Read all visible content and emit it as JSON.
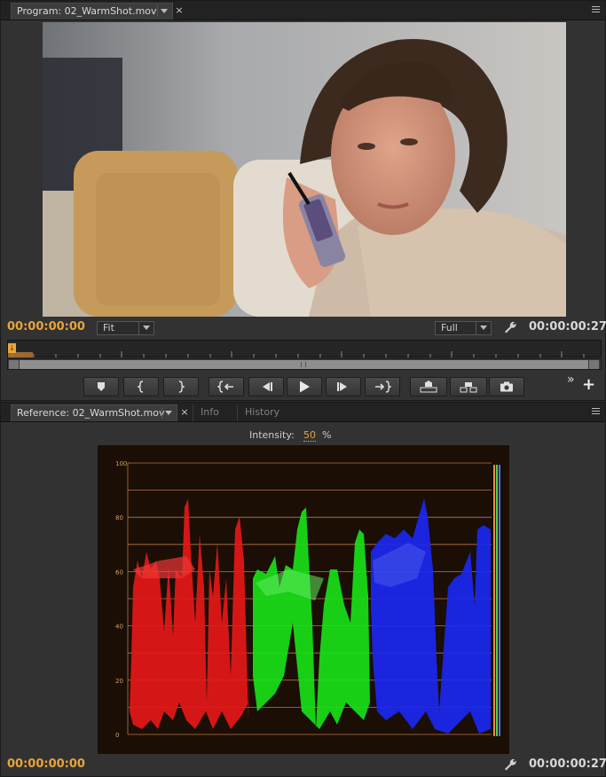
{
  "program_panel": {
    "tab_title": "Program: 02_WarmShot.mov",
    "close_label": "×",
    "current_timecode": "00:00:00:00",
    "zoom_dropdown": "Fit",
    "quality_dropdown": "Full",
    "duration_timecode": "00:00:00:27",
    "playhead_marker": "↓",
    "more_label": "»",
    "add_label": "+",
    "transport_buttons": [
      {
        "name": "add-marker-button",
        "icon": "marker-icon"
      },
      {
        "name": "mark-in-button",
        "icon": "mark-in-icon",
        "label": "{"
      },
      {
        "name": "mark-out-button",
        "icon": "mark-out-icon",
        "label": "}"
      },
      {
        "name": "go-to-in-button",
        "icon": "go-to-in-icon",
        "label": "{←"
      },
      {
        "name": "step-back-button",
        "icon": "step-back-icon"
      },
      {
        "name": "play-button",
        "icon": "play-icon"
      },
      {
        "name": "step-forward-button",
        "icon": "step-forward-icon"
      },
      {
        "name": "go-to-out-button",
        "icon": "go-to-out-icon",
        "label": "→}"
      },
      {
        "name": "lift-button",
        "icon": "lift-icon"
      },
      {
        "name": "extract-button",
        "icon": "extract-icon"
      },
      {
        "name": "export-frame-button",
        "icon": "camera-icon"
      }
    ]
  },
  "reference_panel": {
    "tab_title": "Reference: 02_WarmShot.mov",
    "close_label": "×",
    "tabs": [
      "Info",
      "History"
    ],
    "intensity_label": "Intensity:",
    "intensity_value": "50",
    "intensity_unit": "%",
    "current_timecode": "00:00:00:00",
    "duration_timecode": "00:00:00:27"
  },
  "scope": {
    "type": "RGB parade",
    "ticks": [
      "100",
      "80",
      "60",
      "40",
      "20",
      "0"
    ],
    "colors": {
      "red": "#ff2020",
      "green": "#20ff20",
      "blue": "#2030ff",
      "grid": "#d88a50"
    }
  },
  "colors": {
    "accent_timecode": "#e8a53a",
    "panel_bg": "#323232"
  }
}
